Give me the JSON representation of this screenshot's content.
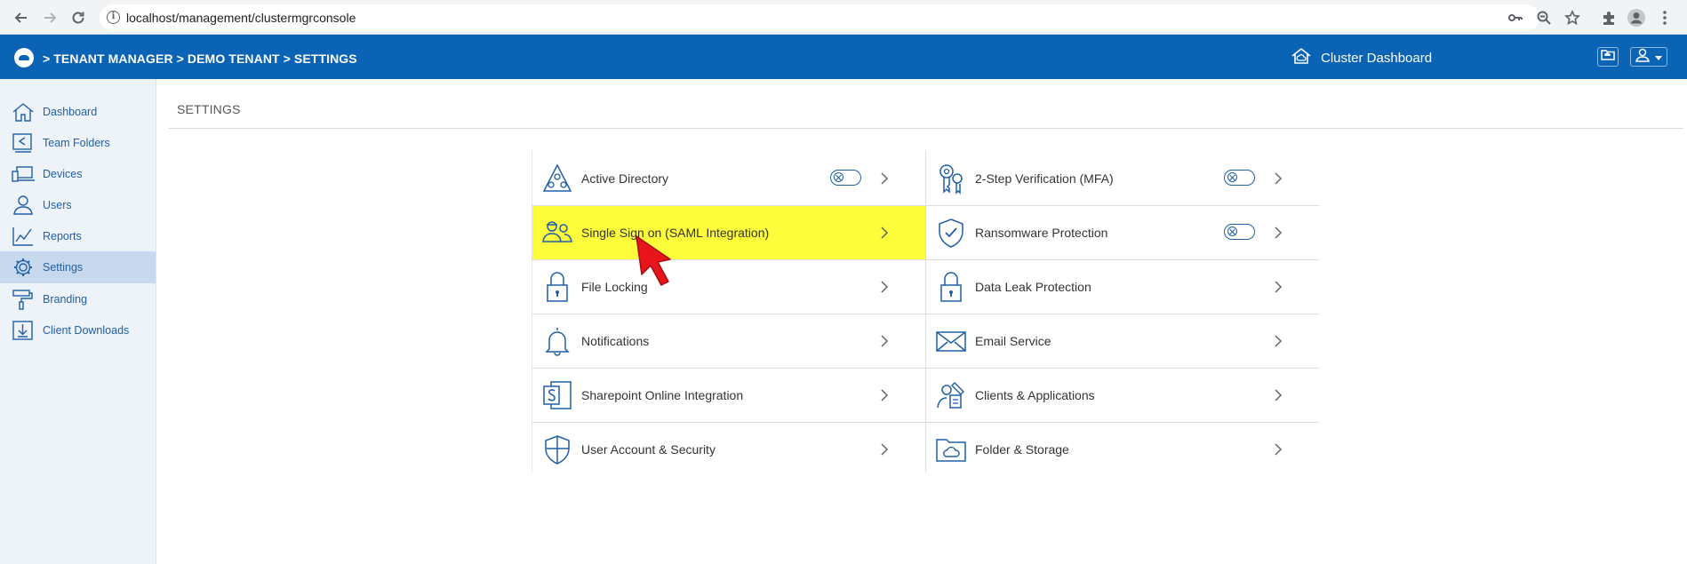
{
  "browser": {
    "url": "localhost/management/clustermgrconsole"
  },
  "header": {
    "breadcrumb": "> TENANT MANAGER > DEMO TENANT  > SETTINGS",
    "cluster_dashboard": "Cluster Dashboard"
  },
  "sidebar": {
    "items": [
      {
        "label": "Dashboard",
        "icon": "home-icon"
      },
      {
        "label": "Team Folders",
        "icon": "team-folder-icon"
      },
      {
        "label": "Devices",
        "icon": "devices-icon"
      },
      {
        "label": "Users",
        "icon": "users-icon"
      },
      {
        "label": "Reports",
        "icon": "reports-icon"
      },
      {
        "label": "Settings",
        "icon": "gear-icon",
        "active": true
      },
      {
        "label": "Branding",
        "icon": "paint-roller-icon"
      },
      {
        "label": "Client Downloads",
        "icon": "download-icon"
      }
    ]
  },
  "main": {
    "title": "SETTINGS",
    "left_column": [
      {
        "label": "Active Directory",
        "icon": "active-directory-icon",
        "toggle": true
      },
      {
        "label": "Single Sign on (SAML Integration)",
        "icon": "sso-users-icon",
        "toggle": false,
        "highlighted": true
      },
      {
        "label": "File Locking",
        "icon": "lock-icon",
        "toggle": false
      },
      {
        "label": "Notifications",
        "icon": "bell-icon",
        "toggle": false
      },
      {
        "label": "Sharepoint Online Integration",
        "icon": "sharepoint-icon",
        "toggle": false
      },
      {
        "label": "User Account & Security",
        "icon": "shield-icon",
        "toggle": false
      }
    ],
    "right_column": [
      {
        "label": "2-Step Verification (MFA)",
        "icon": "key-icon",
        "toggle": true
      },
      {
        "label": "Ransomware Protection",
        "icon": "shield-check-icon",
        "toggle": true
      },
      {
        "label": "Data Leak Protection",
        "icon": "lock-icon",
        "toggle": false
      },
      {
        "label": "Email Service",
        "icon": "envelope-icon",
        "toggle": false
      },
      {
        "label": "Clients & Applications",
        "icon": "clients-apps-icon",
        "toggle": false
      },
      {
        "label": "Folder & Storage",
        "icon": "folder-cloud-icon",
        "toggle": false
      }
    ]
  },
  "colors": {
    "header_bg": "#0b63b6",
    "accent": "#1f5fa8",
    "highlight": "#fdfd3c",
    "cursor": "#e8141c"
  }
}
